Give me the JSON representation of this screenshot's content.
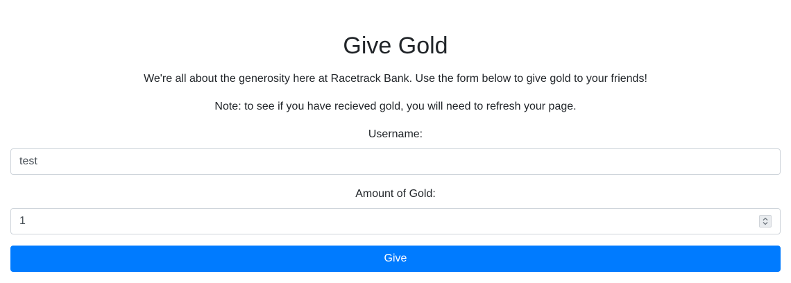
{
  "page": {
    "title": "Give Gold",
    "intro": "We're all about the generosity here at Racetrack Bank. Use the form below to give gold to your friends!",
    "note": "Note: to see if you have recieved gold, you will need to refresh your page."
  },
  "form": {
    "username_label": "Username:",
    "username_value": "test",
    "amount_label": "Amount of Gold:",
    "amount_value": "1",
    "submit_label": "Give"
  },
  "colors": {
    "accent": "#007bff",
    "text": "#212529",
    "border": "#ced4da"
  },
  "icons": {
    "spinner": "number-spinner-icon"
  }
}
